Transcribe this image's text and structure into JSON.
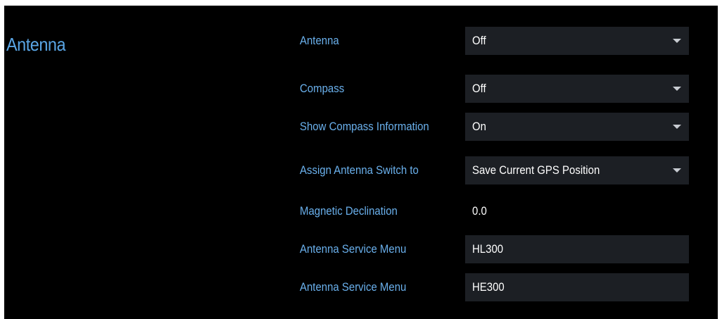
{
  "section": {
    "title": "Antenna"
  },
  "settings": [
    {
      "label": "Antenna",
      "value": "Off",
      "control": "dropdown"
    },
    {
      "label": "Compass",
      "value": "Off",
      "control": "dropdown"
    },
    {
      "label": "Show Compass Information",
      "value": "On",
      "control": "dropdown"
    },
    {
      "label": "Assign Antenna Switch to",
      "value": "Save Current GPS Position",
      "control": "dropdown"
    },
    {
      "label": "Magnetic Declination",
      "value": "0.0",
      "control": "static"
    },
    {
      "label": "Antenna Service Menu",
      "value": "HL300",
      "control": "button"
    },
    {
      "label": "Antenna Service Menu",
      "value": "HE300",
      "control": "button"
    }
  ],
  "colors": {
    "background": "#000000",
    "label_text": "#6ab0ec",
    "title_text": "#5aa6e6",
    "control_bg": "#1c1f24",
    "value_text": "#ffffff"
  },
  "icons": {
    "dropdown_arrow": "chevron-down-icon"
  }
}
